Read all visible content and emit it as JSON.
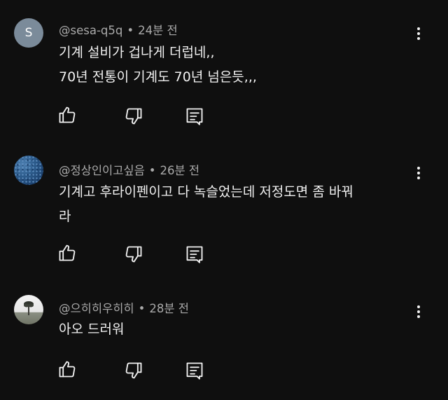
{
  "comments": [
    {
      "author": "@sesa-q5q",
      "time": "24분 전",
      "avatar_letter": "S",
      "lines": [
        "기계 설비가 겁나게 더럽네,,",
        "70년 전통이 기계도 70년 넘은듯,,,"
      ]
    },
    {
      "author": "@정상인이고싶음",
      "time": "26분 전",
      "lines": [
        "기계고 후라이펜이고 다 녹슬었는데 저정도면 좀 바꿔",
        "라"
      ]
    },
    {
      "author": "@으히히우히히",
      "time": "28분 전",
      "lines": [
        "아오 드러워"
      ]
    }
  ],
  "separator": "•",
  "icons": {
    "like": "thumbs-up-icon",
    "dislike": "thumbs-down-icon",
    "reply": "reply-icon",
    "more": "more-vert-icon"
  },
  "colors": {
    "background": "#0f0f0f",
    "text": "#f1f1f1",
    "meta": "#aaaaaa"
  }
}
